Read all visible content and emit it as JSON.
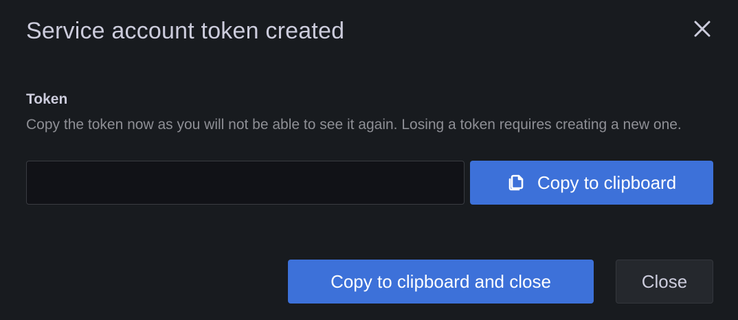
{
  "modal": {
    "title": "Service account token created"
  },
  "token_field": {
    "label": "Token",
    "description": "Copy the token now as you will not be able to see it again. Losing a token requires creating a new one.",
    "value": ""
  },
  "buttons": {
    "copy_label": "Copy to clipboard",
    "copy_and_close_label": "Copy to clipboard and close",
    "close_label": "Close"
  },
  "icons": {
    "close": "close-icon",
    "copy": "copy-icon"
  },
  "colors": {
    "background": "#181b1f",
    "primary": "#3d71d9",
    "secondary": "#25282d",
    "text": "#ccccdc",
    "muted_text": "#8e8f95"
  }
}
